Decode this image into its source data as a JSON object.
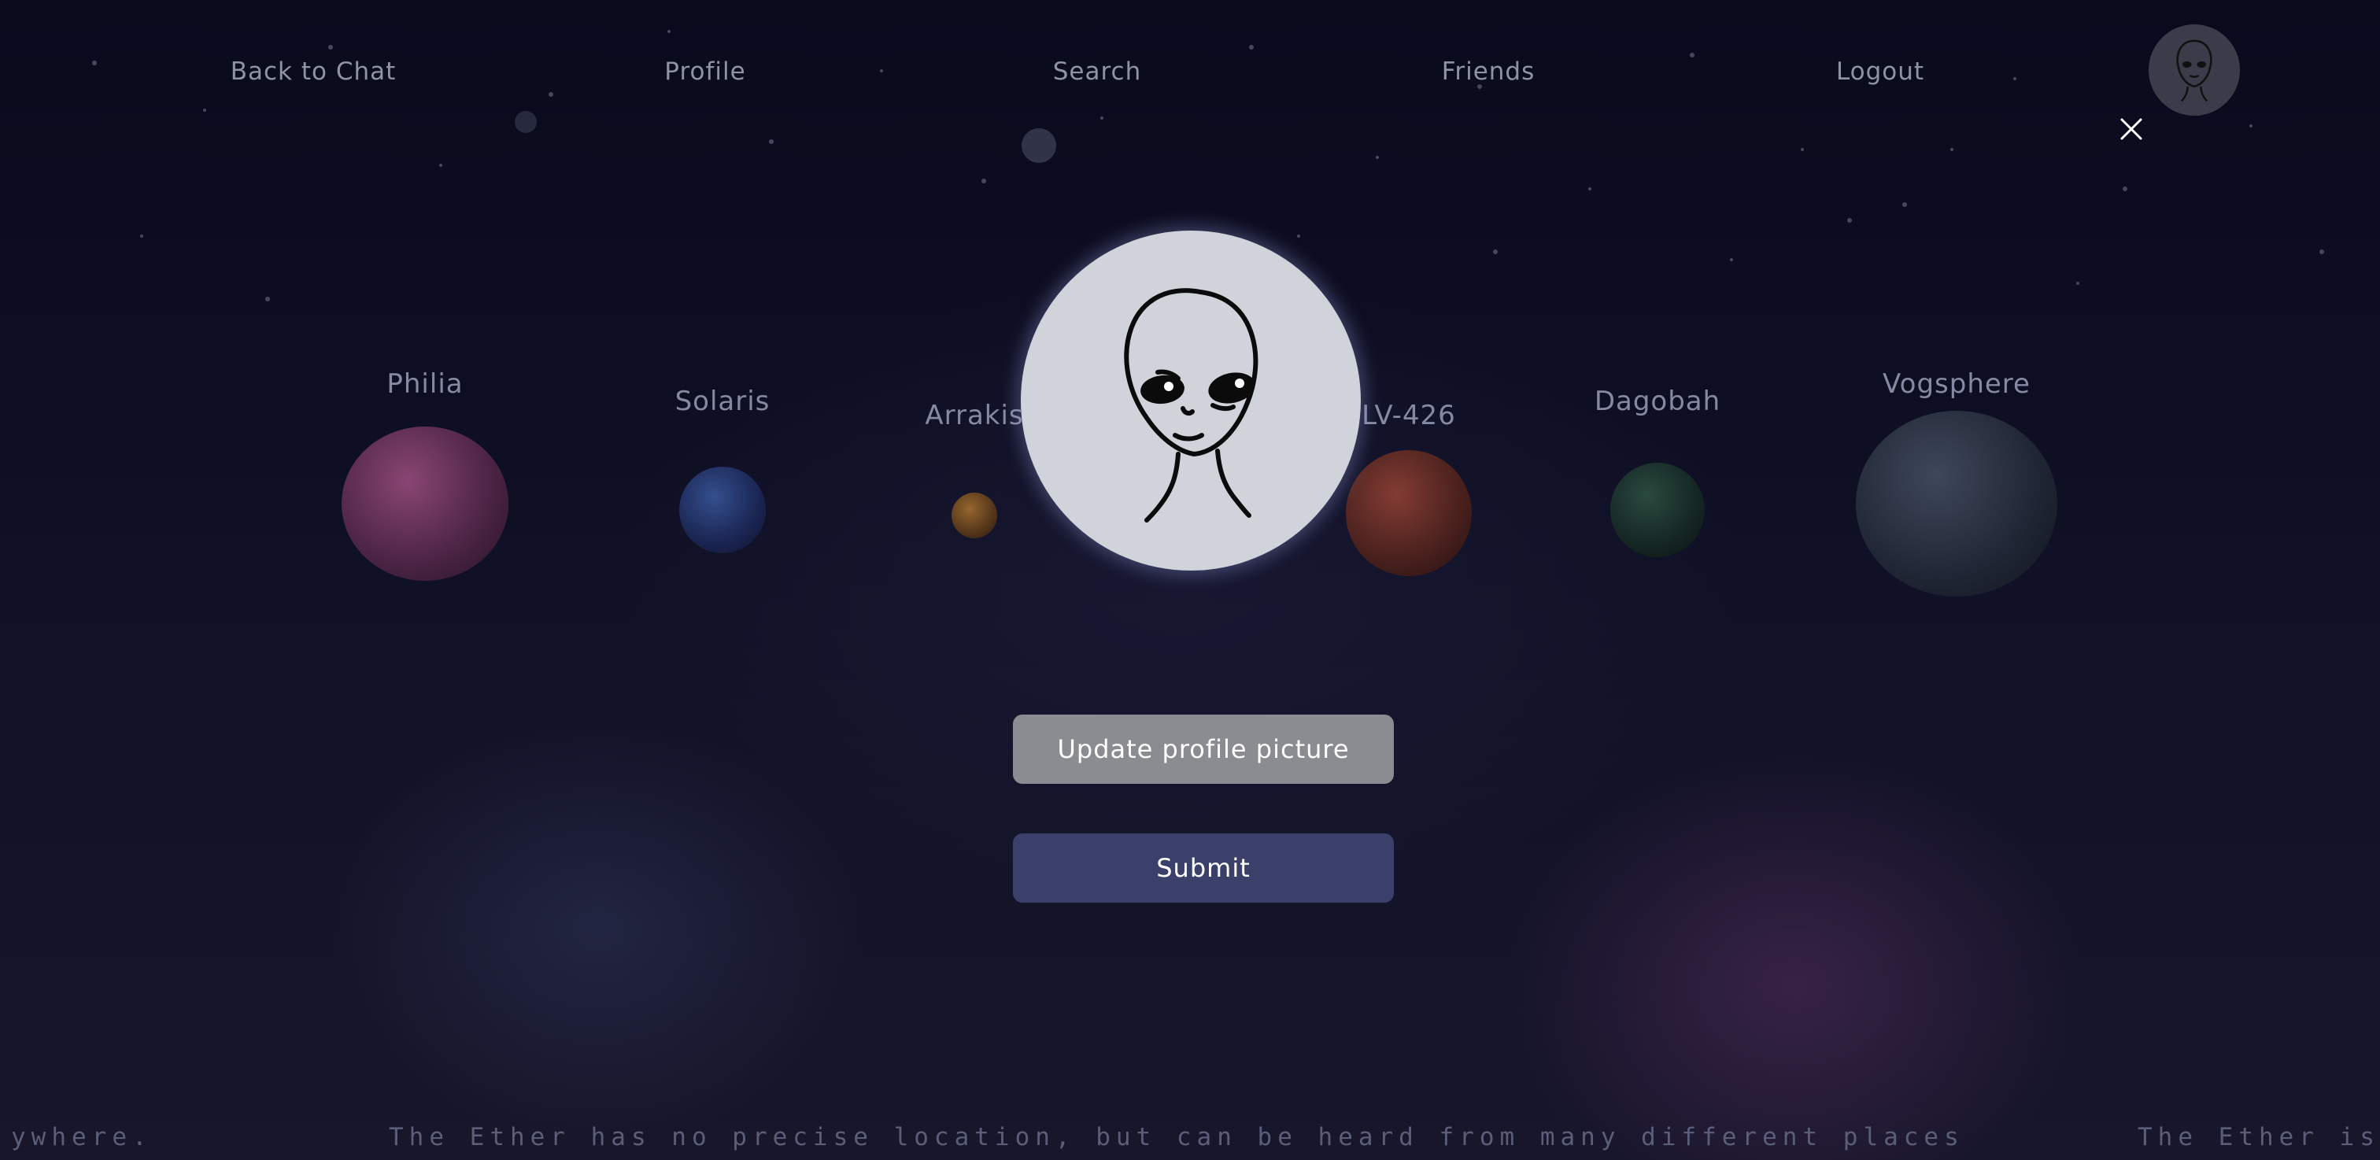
{
  "nav": {
    "items": [
      {
        "label": "Back to Chat"
      },
      {
        "label": "Profile"
      },
      {
        "label": "Search"
      },
      {
        "label": "Friends"
      },
      {
        "label": "Logout"
      }
    ],
    "avatar_icon": "alien-avatar-icon"
  },
  "planets": [
    {
      "name": "Philia",
      "color": "#8a3e6e"
    },
    {
      "name": "Solaris",
      "color": "#2c3f7a"
    },
    {
      "name": "Arrakis",
      "color": "#7a4a1c"
    },
    {
      "name": "LV-426",
      "color": "#7a2f22"
    },
    {
      "name": "Dagobah",
      "color": "#1e3a30"
    },
    {
      "name": "Vogsphere",
      "color": "#2b3444"
    }
  ],
  "modal": {
    "close_icon": "close-icon",
    "avatar_icon": "alien-avatar-icon",
    "update_label": "Update profile picture",
    "submit_label": "Submit"
  },
  "footer": {
    "marquee_left": "ywhere.",
    "marquee_main": "The Ether has no precise location, but can be heard from many different places",
    "marquee_right": "The Ether is"
  },
  "colors": {
    "background": "#0b0b1e",
    "update_button": "#8a8c92",
    "submit_button": "#3a406a",
    "avatar_bg": "#d0d4da"
  }
}
